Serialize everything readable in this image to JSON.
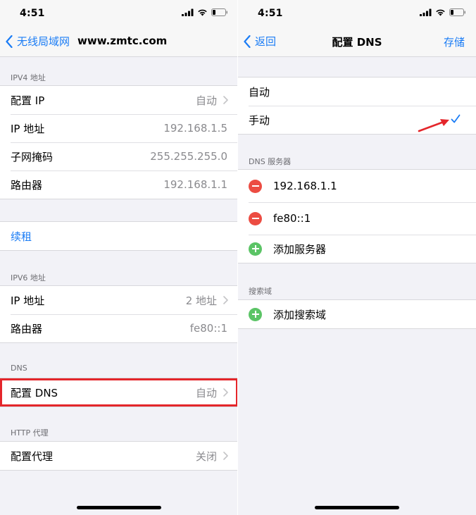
{
  "left": {
    "status": {
      "time": "4:51"
    },
    "nav": {
      "back_label": "无线局域网",
      "title": "www.zmtc.com"
    },
    "ipv4": {
      "header": "IPV4 地址",
      "rows": [
        {
          "label": "配置 IP",
          "value": "自动"
        },
        {
          "label": "IP 地址",
          "value": "192.168.1.5"
        },
        {
          "label": "子网掩码",
          "value": "255.255.255.0"
        },
        {
          "label": "路由器",
          "value": "192.168.1.1"
        }
      ]
    },
    "renew": {
      "label": "续租"
    },
    "ipv6": {
      "header": "IPV6 地址",
      "rows": [
        {
          "label": "IP 地址",
          "value": "2 地址"
        },
        {
          "label": "路由器",
          "value": "fe80::1"
        }
      ]
    },
    "dns": {
      "header": "DNS",
      "row": {
        "label": "配置 DNS",
        "value": "自动"
      }
    },
    "http_proxy": {
      "header": "HTTP 代理",
      "row": {
        "label": "配置代理",
        "value": "关闭"
      }
    }
  },
  "right": {
    "status": {
      "time": "4:51"
    },
    "nav": {
      "back_label": "返回",
      "title": "配置 DNS",
      "save_label": "存储"
    },
    "mode": {
      "options": [
        {
          "label": "自动"
        },
        {
          "label": "手动"
        }
      ],
      "selected_index": 1
    },
    "dns_servers": {
      "header": "DNS 服务器",
      "items": [
        "192.168.1.1",
        "fe80::1"
      ],
      "add_label": "添加服务器"
    },
    "search_domains": {
      "header": "搜索域",
      "add_label": "添加搜索域"
    }
  },
  "colors": {
    "accent": "#1a7cf5",
    "highlight_box": "#e4262b",
    "annotation_arrow": "#e4262b",
    "delete": "#ec4c42",
    "add": "#5bc466"
  }
}
